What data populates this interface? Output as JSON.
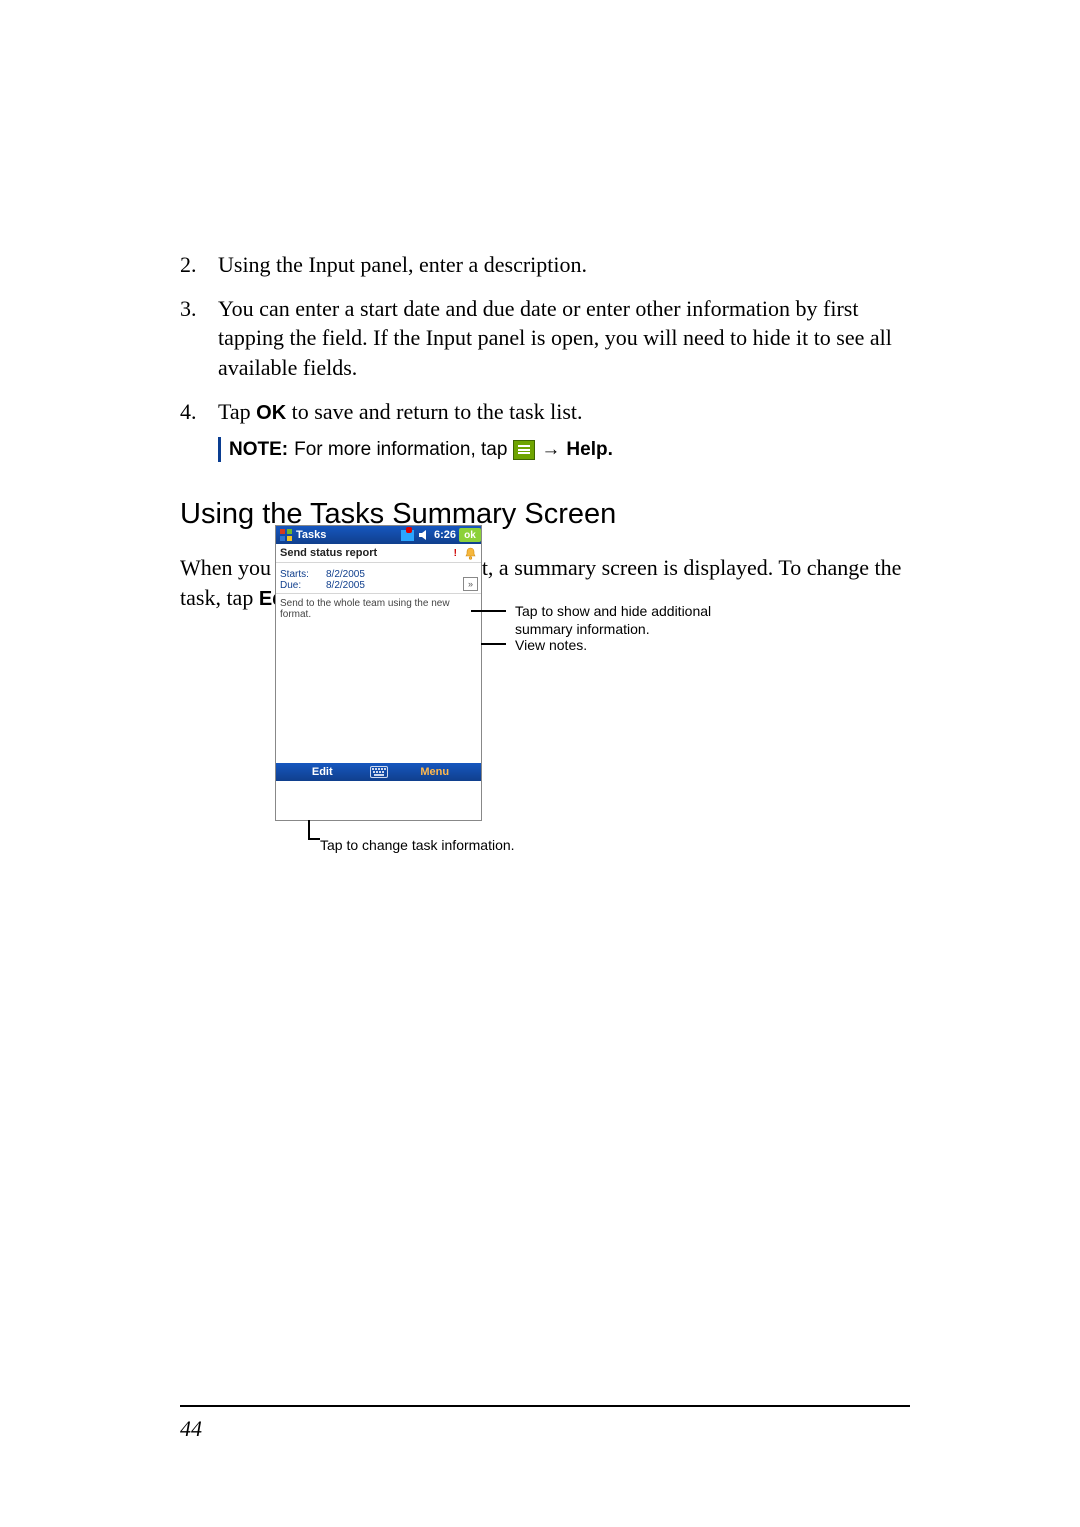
{
  "steps": [
    {
      "n": "2.",
      "text": "Using the Input panel, enter a description."
    },
    {
      "n": "3.",
      "text": "You can enter a start date and due date or enter other information by first tapping the field. If the Input panel is open, you will need to hide it to see all available fields."
    },
    {
      "n": "4.",
      "prefix": "Tap ",
      "bold": "OK",
      "suffix": " to save and return to the task list."
    }
  ],
  "note": {
    "label": "NOTE:",
    "before": " For more information, tap ",
    "arrow": "→",
    "after_bold": "Help."
  },
  "section_heading": "Using the Tasks Summary Screen",
  "intro": {
    "line1": "When you tap a task in the task list, a summary screen is displayed. To change the task, tap ",
    "bold": "Edit",
    "suffix": "."
  },
  "device": {
    "title": "Tasks",
    "time": "6:26",
    "ok": "ok",
    "task_name": "Send status report",
    "bang": "!",
    "starts_label": "Starts:",
    "starts_val": "8/2/2005",
    "due_label": "Due:",
    "due_val": "8/2/2005",
    "expand_glyph": "»",
    "notes": "Send to the whole team using the new format.",
    "edit": "Edit",
    "menu": "Menu"
  },
  "callouts": {
    "show_hide": "Tap to show and hide additional summary information.",
    "view_notes": "View notes.",
    "change_info": "Tap to change task information."
  },
  "page_number": "44"
}
